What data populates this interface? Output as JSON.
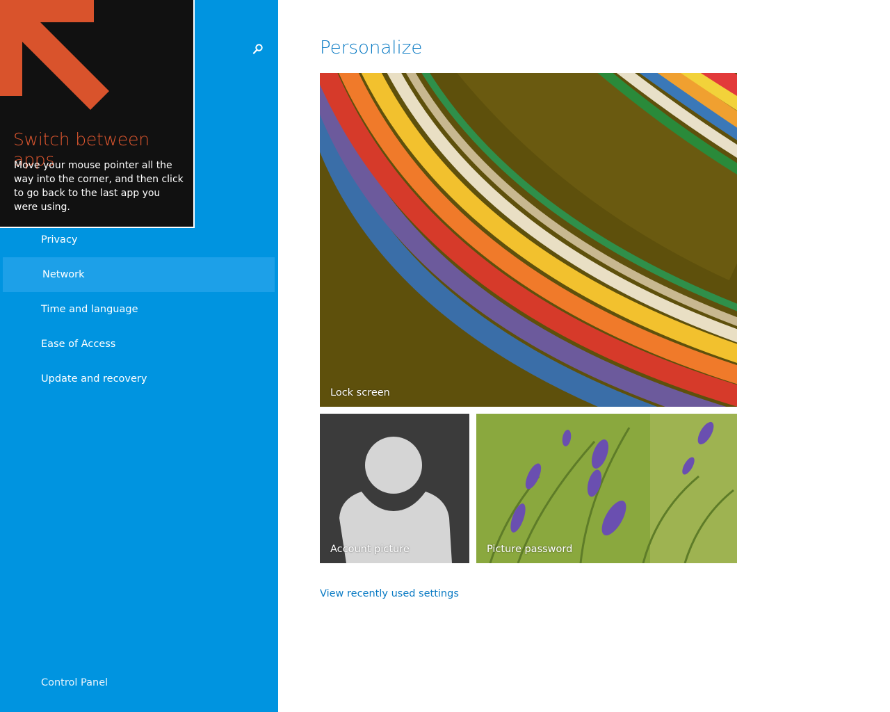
{
  "sidebar": {
    "search_icon": "search-icon",
    "items": [
      {
        "label": "Privacy",
        "selected": false
      },
      {
        "label": "Network",
        "selected": true
      },
      {
        "label": "Time and language",
        "selected": false
      },
      {
        "label": "Ease of Access",
        "selected": false
      },
      {
        "label": "Update and recovery",
        "selected": false
      }
    ],
    "control_panel": "Control Panel"
  },
  "tip": {
    "title": "Switch between apps",
    "body": "Move your mouse pointer all the way into the corner, and then click to go back to the last app you were using."
  },
  "main": {
    "title": "Personalize",
    "tiles": {
      "lock_screen": "Lock screen",
      "account_picture": "Account picture",
      "picture_password": "Picture password"
    },
    "recent_link": "View recently used settings"
  },
  "colors": {
    "sidebar_bg": "#0094e0",
    "selected_item": "#1da0e8",
    "accent_text": "#0b7bc4",
    "tip_title": "#e0572f",
    "arrow": "#d9532c"
  }
}
